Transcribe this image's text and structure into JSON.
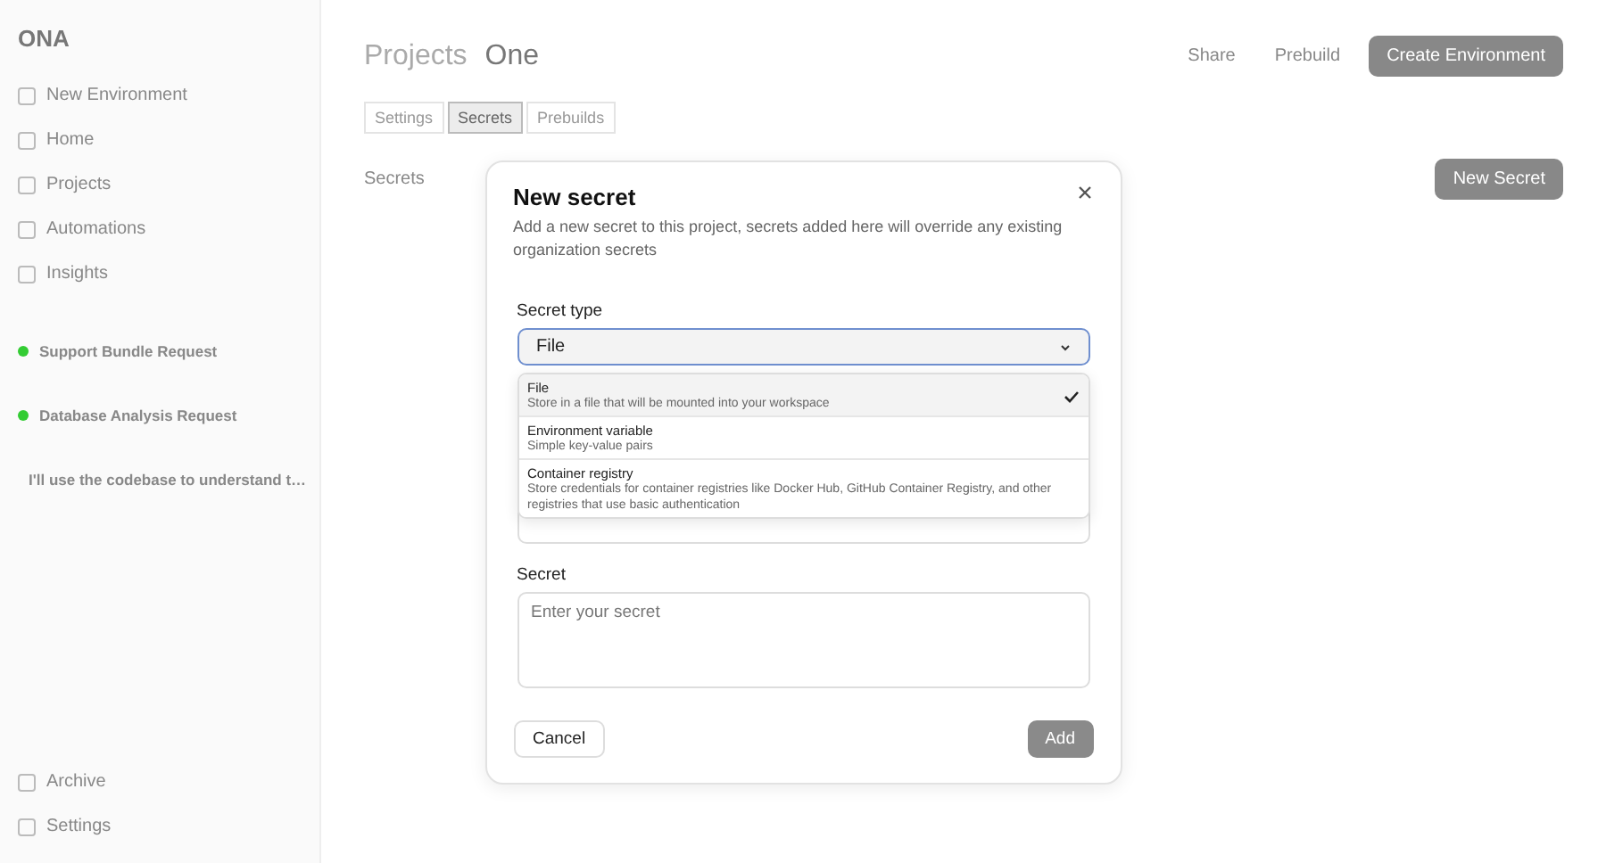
{
  "sidebar": {
    "brand": "ONA",
    "new_environment": "New Environment",
    "nav": [
      {
        "label": "Home"
      },
      {
        "label": "Projects"
      },
      {
        "label": "Automations"
      },
      {
        "label": "Insights"
      }
    ],
    "environments": [
      {
        "title": "Support Bundle Request"
      },
      {
        "title": "Database Analysis Request"
      },
      {
        "title": "I'll use the codebase to understand t…"
      }
    ],
    "footer": [
      {
        "label": "Archive"
      },
      {
        "label": "Settings"
      }
    ]
  },
  "header": {
    "breadcrumb": [
      "Projects",
      "One"
    ],
    "actions": [
      "Share",
      "Prebuild"
    ],
    "primary": "Create Environment"
  },
  "tabs": [
    {
      "label": "Settings",
      "selected": false
    },
    {
      "label": "Secrets",
      "selected": true
    },
    {
      "label": "Prebuilds",
      "selected": false
    }
  ],
  "section": {
    "title": "Secrets",
    "button": "New Secret"
  },
  "dialog": {
    "title": "New secret",
    "description": "Add a new secret to this project, secrets added here will override any existing organization secrets",
    "type_label": "Secret type",
    "type_value": "File",
    "options": [
      {
        "title": "File",
        "description": "Store in a file that will be mounted into your workspace",
        "selected": true
      },
      {
        "title": "Environment variable",
        "description": "Simple key-value pairs",
        "selected": false
      },
      {
        "title": "Container registry",
        "description": "Store credentials for container registries like Docker Hub, GitHub Container Registry, and other registries that use basic authentication",
        "selected": false
      }
    ],
    "secret_label": "Secret",
    "secret_placeholder": "Enter your secret",
    "cancel": "Cancel",
    "add": "Add"
  }
}
